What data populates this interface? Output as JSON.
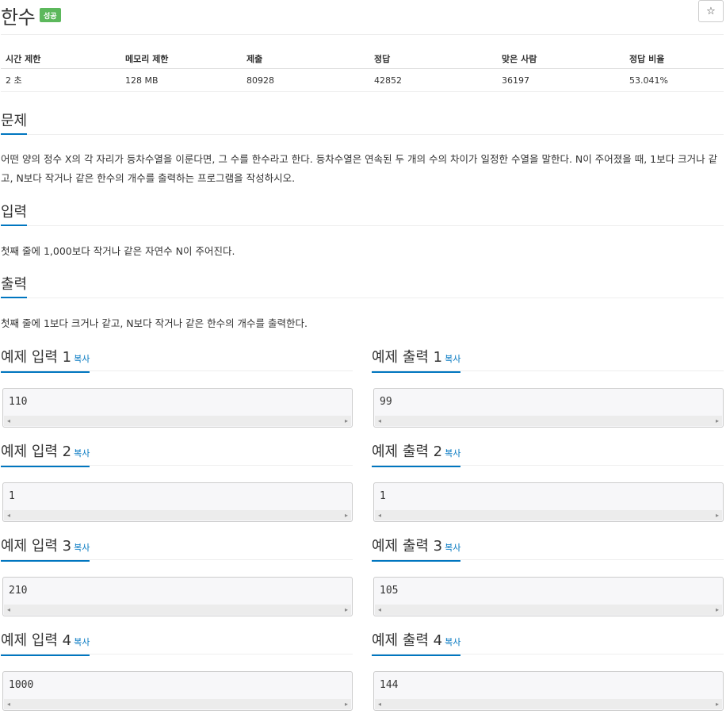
{
  "problem": {
    "title": "한수",
    "status_badge": "성공",
    "star_icon": "☆"
  },
  "info_table": {
    "headers": [
      "시간 제한",
      "메모리 제한",
      "제출",
      "정답",
      "맞은 사람",
      "정답 비율"
    ],
    "row": [
      "2 초",
      "128 MB",
      "80928",
      "42852",
      "36197",
      "53.041%"
    ]
  },
  "sections": {
    "description": {
      "title": "문제",
      "text": "어떤 양의 정수 X의 각 자리가 등차수열을 이룬다면, 그 수를 한수라고 한다. 등차수열은 연속된 두 개의 수의 차이가 일정한 수열을 말한다. N이 주어졌을 때, 1보다 크거나 같고, N보다 작거나 같은 한수의 개수를 출력하는 프로그램을 작성하시오."
    },
    "input": {
      "title": "입력",
      "text": "첫째 줄에 1,000보다 작거나 같은 자연수 N이 주어진다."
    },
    "output": {
      "title": "출력",
      "text": "첫째 줄에 1보다 크거나 같고, N보다 작거나 같은 한수의 개수를 출력한다."
    }
  },
  "copy_label": "복사",
  "samples": [
    {
      "input_title": "예제 입력 1",
      "input": "110",
      "output_title": "예제 출력 1",
      "output": "99"
    },
    {
      "input_title": "예제 입력 2",
      "input": "1",
      "output_title": "예제 출력 2",
      "output": "1"
    },
    {
      "input_title": "예제 입력 3",
      "input": "210",
      "output_title": "예제 출력 3",
      "output": "105"
    },
    {
      "input_title": "예제 입력 4",
      "input": "1000",
      "output_title": "예제 출력 4",
      "output": "144"
    }
  ],
  "scroll_arrows": {
    "left": "◂",
    "right": "▸"
  },
  "colors": {
    "accent": "#0076c0",
    "badge": "#5cb85c",
    "sample_bg": "#f7f7f9"
  }
}
